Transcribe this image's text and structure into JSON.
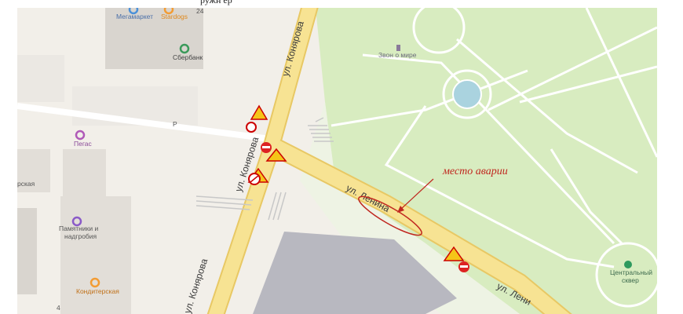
{
  "document": {
    "top_caption_fragment": "ружн                              ер"
  },
  "map": {
    "colors": {
      "park": "#d8ecc0",
      "road": "#f5e08a",
      "ground": "#f2efe9",
      "building": "#d9d5cf",
      "pond": "#aad3df",
      "annotation": "#c0271f"
    },
    "pois": [
      {
        "name": "Мегамаркет",
        "icon": "shopping-icon",
        "color": "#4a90d9"
      },
      {
        "name": "Stardogs",
        "icon": "food-icon",
        "color": "#f39c33"
      },
      {
        "name": "Сбербанк",
        "icon": "bank-icon",
        "color": "#3a9a5a"
      },
      {
        "name": "Пегас",
        "icon": "shop-icon",
        "color": "#b05ab8"
      },
      {
        "name": "Памятники и надгробия",
        "icon": "shop-icon",
        "color": "#8a5ac8"
      },
      {
        "name": "Кондитерская",
        "icon": "food-icon",
        "color": "#f39c33"
      },
      {
        "name": "Центральный сквер",
        "icon": "park-icon",
        "color": "#2e9a5e"
      },
      {
        "name": "Звон о мире",
        "icon": "monument-icon",
        "color": "#8a7a9a"
      }
    ],
    "street_labels": [
      "ул. Конярова",
      "ул. Конярова",
      "ул. Ленина",
      "ул. Лени"
    ],
    "fragment_labels": [
      "рская",
      "Р",
      "24",
      "4"
    ],
    "poi_text": {
      "megamarket": "Мегамаркет",
      "stardogs": "Stardogs",
      "sberbank": "Сбербанк",
      "pegas": "Пегас",
      "pamyatniki_1": "Памятники и",
      "pamyatniki_2": "надгробия",
      "konditerskaya": "Кондитерская",
      "skver_1": "Центральный",
      "skver_2": "сквер",
      "zvon": "Звон о мире"
    },
    "annotation": {
      "text": "место аварии"
    }
  }
}
